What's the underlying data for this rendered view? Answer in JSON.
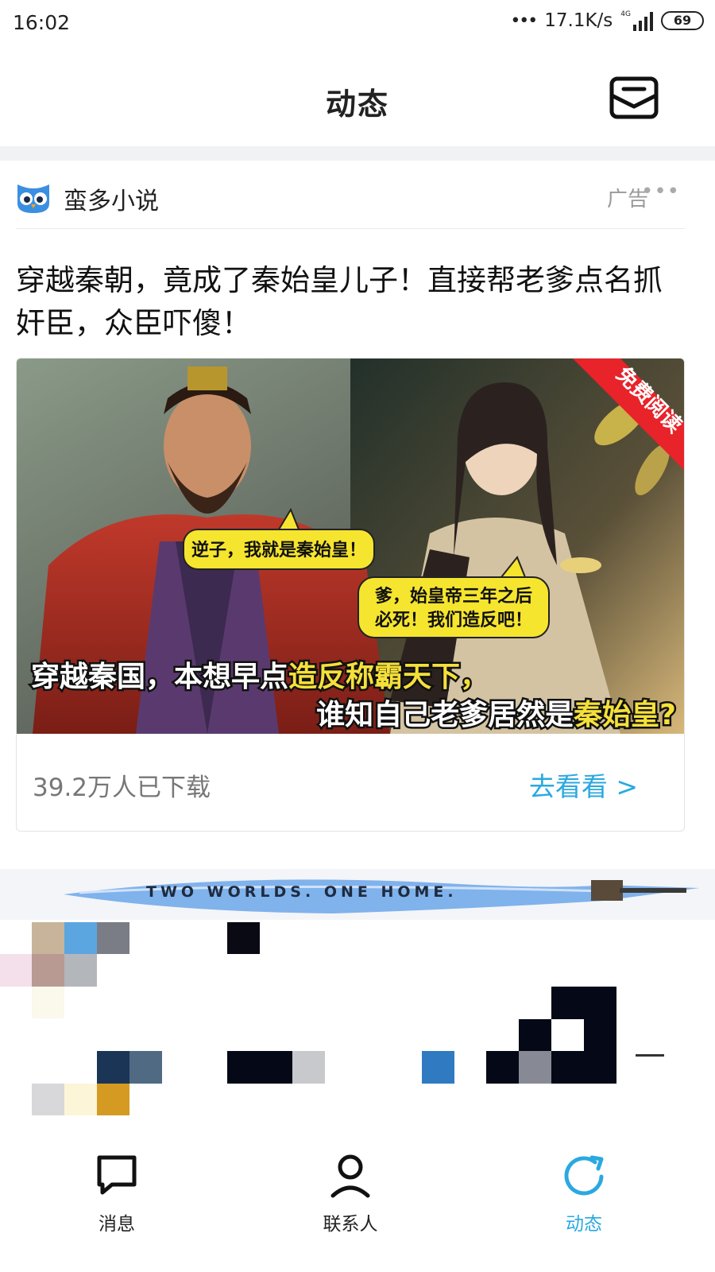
{
  "status_bar": {
    "time": "16:02",
    "network_speed": "17.1K/s",
    "network_type": "4G",
    "battery": "69"
  },
  "header": {
    "title": "动态",
    "mail_icon": "mail-inbox-icon"
  },
  "ad": {
    "source_name": "蛮多小说",
    "ad_label": "广告",
    "more_icon": "more-dots-icon",
    "title": "穿越秦朝，竟成了秦始皇儿子！直接帮老爹点名抓奸臣，众臣吓傻！",
    "image": {
      "corner_ribbon": "免费阅读",
      "bubble_left": "逆子，我就是秦始皇！",
      "bubble_right_line1": "爹，始皇帝三年之后",
      "bubble_right_line2": "必死！我们造反吧！",
      "caption_line1_white": "穿越秦国，本想早点",
      "caption_line1_yellow": "造反称霸天下，",
      "caption_line2_white": "谁知自己老爹居然是",
      "caption_line2_yellow": "秦始皇?"
    },
    "download_count": "39.2万人已下载",
    "action": "去看看 >"
  },
  "banner": {
    "text": "TWO WORLDS. ONE HOME."
  },
  "bottom_nav": {
    "items": [
      {
        "label": "消息",
        "icon": "chat-bubble-icon",
        "active": false
      },
      {
        "label": "联系人",
        "icon": "contacts-person-icon",
        "active": false
      },
      {
        "label": "动态",
        "icon": "moments-refresh-icon",
        "active": true
      }
    ]
  },
  "colors": {
    "accent": "#2aa9e0",
    "text_primary": "#222222",
    "text_secondary": "#777777",
    "caption_yellow": "#f5e03a",
    "ribbon_red": "#e8232a"
  }
}
